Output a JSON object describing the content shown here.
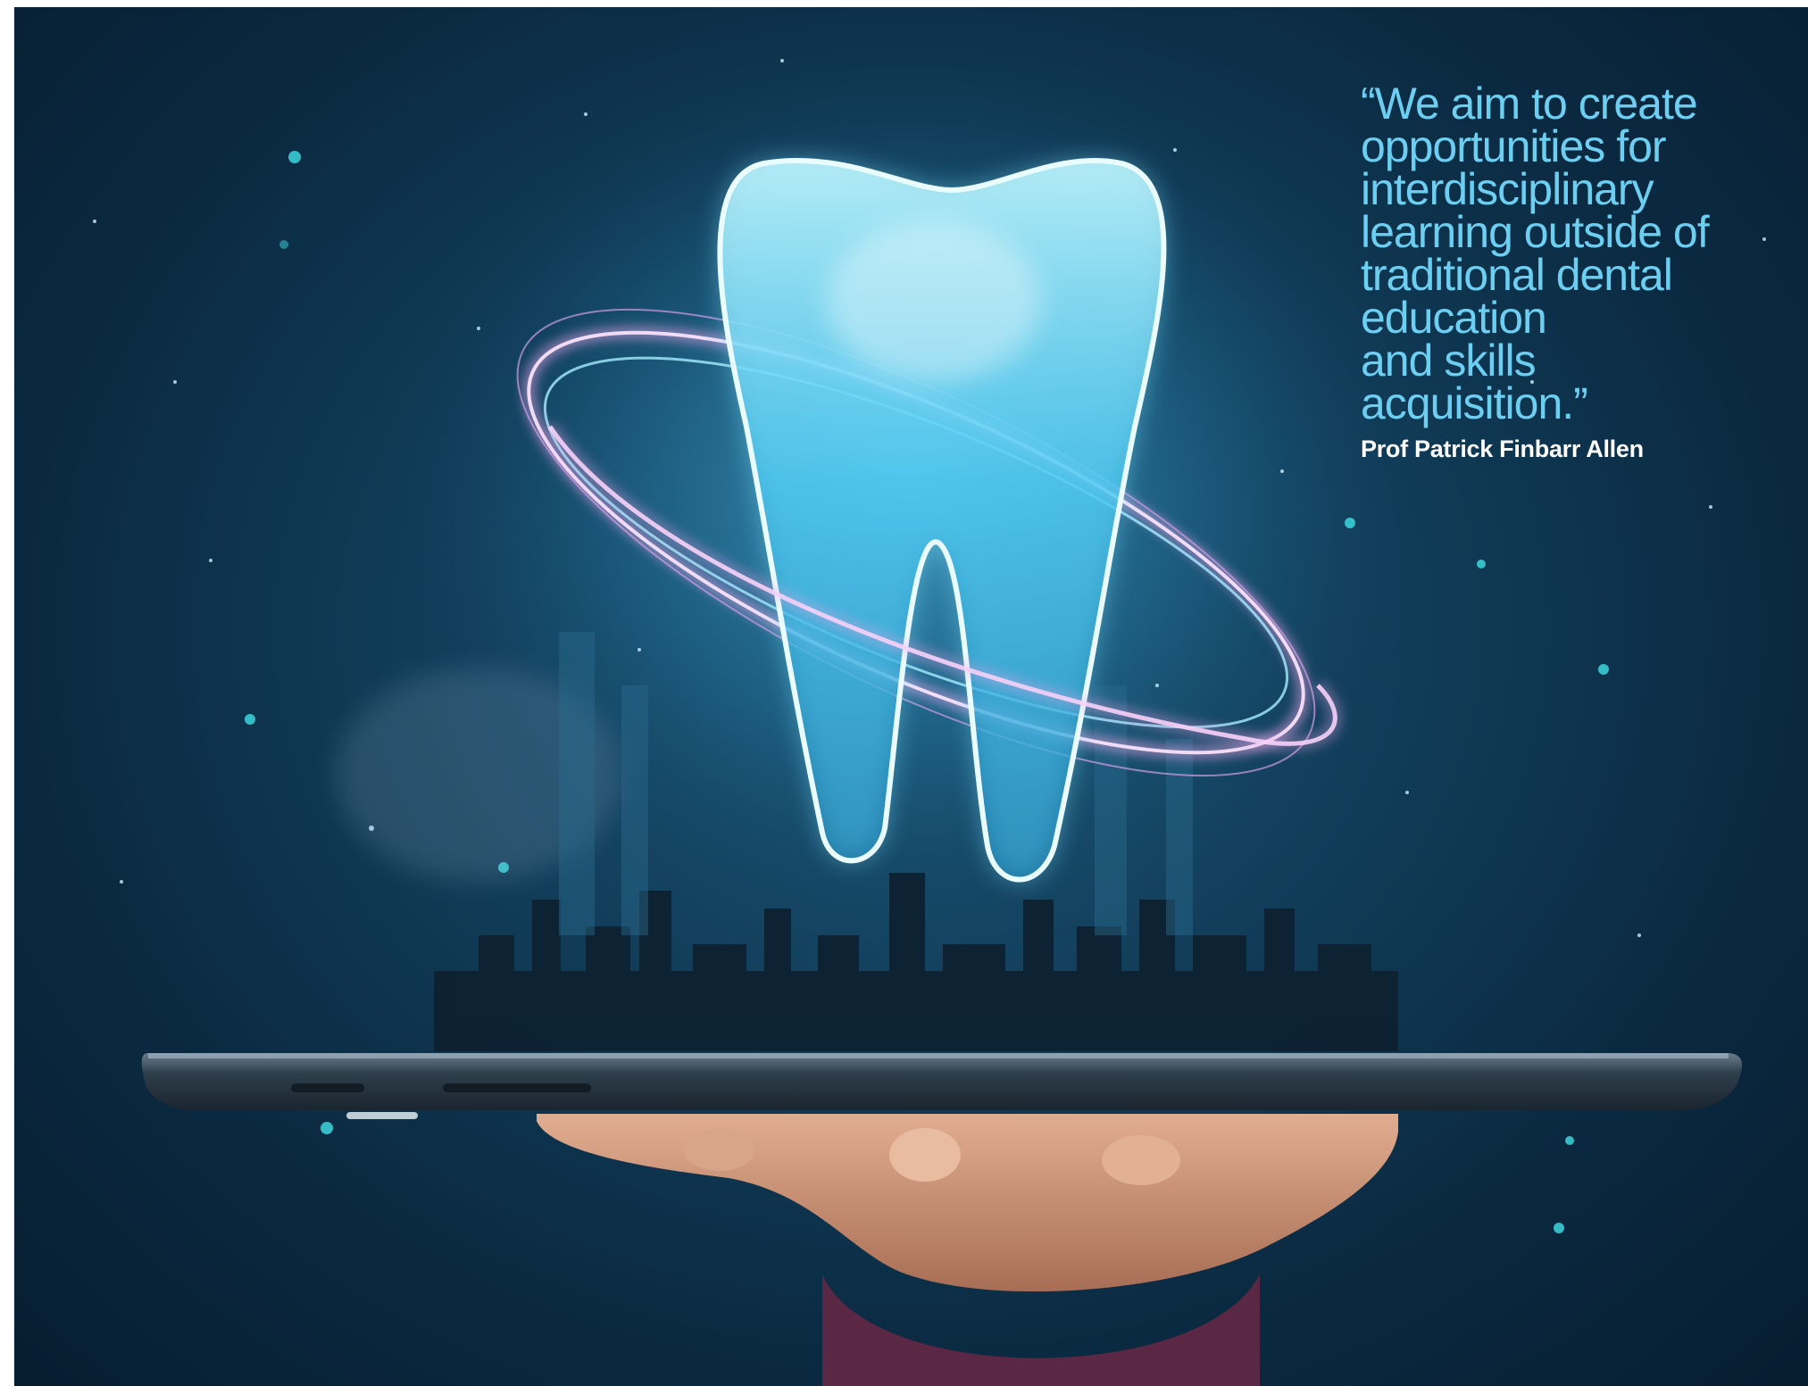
{
  "quote": {
    "text": "“We aim to create\nopportunities for\ninterdisciplinary\nlearning outside of\ntraditional dental\neducation\nand skills\nacquisition.”",
    "author": "Prof Patrick Finbarr Allen"
  },
  "illustration": {
    "subject": "tooth-hologram-icon",
    "colors": {
      "background_dark": "#071d30",
      "background_mid": "#1d5a7c",
      "glow_cyan": "#6ccff2",
      "ring_pink": "#e7a6e8",
      "tablet": "#2b3b48",
      "hand": "#d49b7e"
    }
  }
}
